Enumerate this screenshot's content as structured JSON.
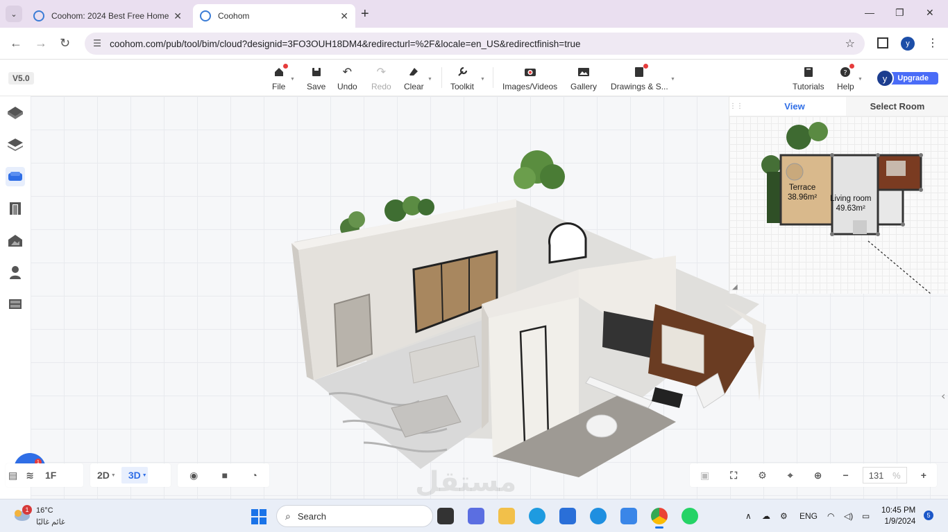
{
  "browser": {
    "tabs": [
      {
        "title": "Coohom: 2024 Best Free Home",
        "active": false
      },
      {
        "title": "Coohom",
        "active": true
      }
    ],
    "url": "coohom.com/pub/tool/bim/cloud?designid=3FO3OUH18DM4&redirecturl=%2F&locale=en_US&redirectfinish=true",
    "profile_initial": "y"
  },
  "toolbar": {
    "version": "V5.0",
    "file": "File",
    "save": "Save",
    "undo": "Undo",
    "redo": "Redo",
    "clear": "Clear",
    "toolkit": "Toolkit",
    "images_videos": "Images/Videos",
    "gallery": "Gallery",
    "drawings": "Drawings & S...",
    "tutorials": "Tutorials",
    "help": "Help",
    "avatar_initial": "y",
    "upgrade": "Upgrade"
  },
  "minimap": {
    "tab_view": "View",
    "tab_select_room": "Select Room",
    "rooms": [
      {
        "name": "Terrace",
        "area": "38.96m²"
      },
      {
        "name": "Living room",
        "area": "49.63m²"
      }
    ]
  },
  "bottom": {
    "floor": "1F",
    "mode_2d": "2D",
    "mode_3d": "3D",
    "zoom_value": "131",
    "zoom_unit": "%",
    "chat_badge": "1",
    "watermark": "مستقل"
  },
  "taskbar": {
    "weather_badge": "1",
    "temperature": "16°C",
    "weather_desc": "غائم غالبًا",
    "search": "Search",
    "language": "ENG",
    "time": "10:45 PM",
    "date": "1/9/2024",
    "notifications": "5"
  },
  "colors": {
    "accent": "#2f6ee6",
    "upgrade": "#4a6cf7",
    "badge_red": "#e63c3c"
  }
}
